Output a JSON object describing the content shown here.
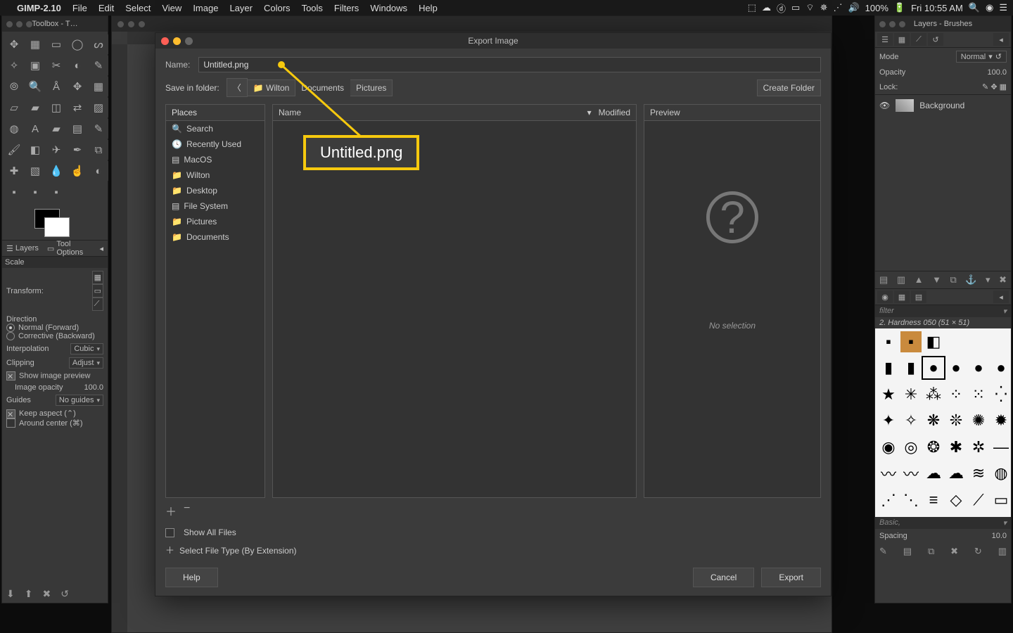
{
  "menubar": {
    "app": "GIMP-2.10",
    "items": [
      "File",
      "Edit",
      "Select",
      "View",
      "Image",
      "Layer",
      "Colors",
      "Tools",
      "Filters",
      "Windows",
      "Help"
    ],
    "battery": "100%",
    "clock": "Fri 10:55 AM"
  },
  "toolbox": {
    "title": "Toolbox - T…",
    "tabs": {
      "layers": "Layers",
      "toolopts": "Tool Options"
    },
    "scale_header": "Scale",
    "transform_label": "Transform:",
    "direction_label": "Direction",
    "dir_normal": "Normal (Forward)",
    "dir_corrective": "Corrective (Backward)",
    "interp_label": "Interpolation",
    "interp_value": "Cubic",
    "clip_label": "Clipping",
    "clip_value": "Adjust",
    "show_preview": "Show image preview",
    "image_opacity_label": "Image opacity",
    "image_opacity_value": "100.0",
    "guides_label": "Guides",
    "guides_value": "No guides",
    "keep_aspect": "Keep aspect (⌃)",
    "around_center": "Around center (⌘)"
  },
  "export": {
    "title": "Export Image",
    "name_label": "Name:",
    "name_value": "Untitled.png",
    "save_label": "Save in folder:",
    "crumb_user": "Wilton",
    "crumb_docs": "Documents",
    "crumb_pics": "Pictures",
    "create_folder": "Create Folder",
    "places_header": "Places",
    "places": [
      "Search",
      "Recently Used",
      "MacOS",
      "Wilton",
      "Desktop",
      "File System",
      "Pictures",
      "Documents"
    ],
    "name_col": "Name",
    "modified_col": "Modified",
    "preview_header": "Preview",
    "no_selection": "No selection",
    "show_all": "Show All Files",
    "select_type": "Select File Type (By Extension)",
    "help": "Help",
    "cancel": "Cancel",
    "export_btn": "Export",
    "callout": "Untitled.png"
  },
  "layers": {
    "title": "Layers - Brushes",
    "mode_label": "Mode",
    "mode_value": "Normal",
    "opacity_label": "Opacity",
    "opacity_value": "100.0",
    "lock_label": "Lock:",
    "layer_name": "Background",
    "filter_label": "filter",
    "brush_name": "2. Hardness 050 (51 × 51)",
    "basic_label": "Basic,",
    "spacing_label": "Spacing",
    "spacing_value": "10.0"
  }
}
